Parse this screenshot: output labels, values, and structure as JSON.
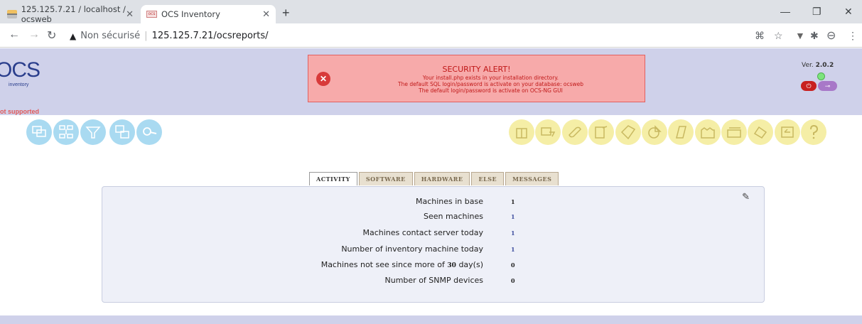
{
  "browser": {
    "tabs": [
      {
        "title": "125.125.7.21 / localhost / ocsweb"
      },
      {
        "title": "OCS Inventory"
      }
    ],
    "url_warning": "Non sécurisé",
    "url": "125.125.7.21/ocsreports/"
  },
  "header": {
    "logo_text": "OCS",
    "logo_sub": "inventory",
    "not_supported": "ot supported",
    "alert": {
      "title": "SECURITY ALERT!",
      "lines": [
        "Your install.php exists in your installation directory.",
        "The default SQL login/password is activate on your database: ocsweb",
        "The default login/password is activate on OCS-NG GUI"
      ]
    },
    "version_label": "Ver.",
    "version": "2.0.2"
  },
  "tabs": [
    {
      "label": "ACTIVITY"
    },
    {
      "label": "SOFTWARE"
    },
    {
      "label": "HARDWARE"
    },
    {
      "label": "ELSE"
    },
    {
      "label": "MESSAGES"
    }
  ],
  "activity": {
    "rows": [
      {
        "label": "Machines in base",
        "value": "1"
      },
      {
        "label": "Seen machines",
        "value": "1"
      },
      {
        "label": "Machines contact server today",
        "value": "1"
      },
      {
        "label": "Number of inventory machine today",
        "value": "1"
      },
      {
        "label_pre": "Machines not see since more of ",
        "label_num": "30",
        "label_post": " day(s)",
        "value": "0"
      },
      {
        "label": "Number of SNMP devices",
        "value": "0"
      }
    ]
  },
  "colors": {
    "header_bg": "#cfd1ea",
    "alert_bg": "#f7aaaa",
    "blue_icon": "#a9daf1",
    "yellow_icon": "#f5eea6"
  }
}
